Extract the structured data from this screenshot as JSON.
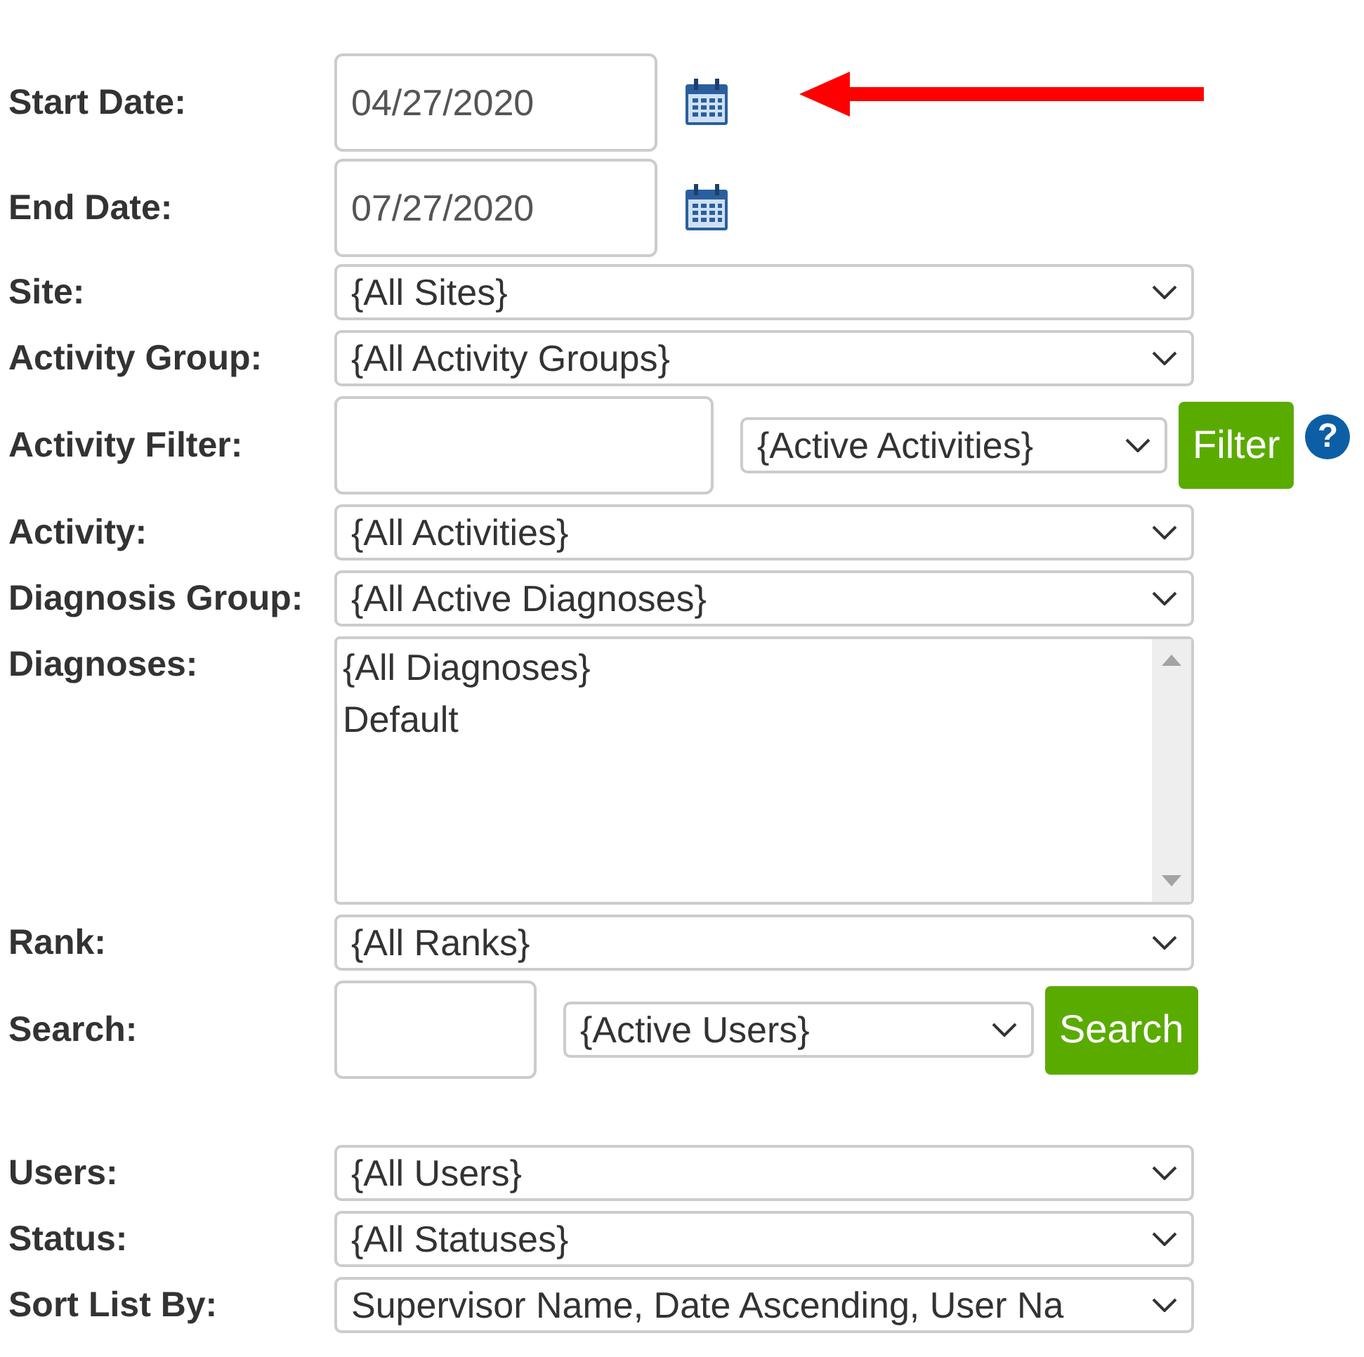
{
  "fields": [
    {
      "kind": "date",
      "label": "Start Date:",
      "value": "04/27/2020",
      "pointed_at": true
    },
    {
      "kind": "date",
      "label": "End Date:",
      "value": "07/27/2020",
      "pointed_at": false
    },
    {
      "kind": "select",
      "label": "Site:",
      "value": "{All Sites}"
    },
    {
      "kind": "select",
      "label": "Activity Group:",
      "value": "{All Activity Groups}"
    },
    {
      "kind": "filter",
      "label": "Activity Filter:",
      "select": "{Active Activities}",
      "button": "Filter",
      "help": "?"
    },
    {
      "kind": "select",
      "label": "Activity:",
      "value": "{All Activities}"
    },
    {
      "kind": "select",
      "label": "Diagnosis Group:",
      "value": "{All Active Diagnoses}"
    },
    {
      "kind": "listbox",
      "label": "Diagnoses:",
      "options": [
        "{All Diagnoses}",
        "Default"
      ]
    },
    {
      "kind": "select",
      "label": "Rank:",
      "value": "{All Ranks}"
    },
    {
      "kind": "search",
      "label": "Search:",
      "select": "{Active Users}",
      "button": "Search"
    },
    {
      "kind": "select",
      "label": "Users:",
      "value": "{All Users}"
    },
    {
      "kind": "select",
      "label": "Status:",
      "value": "{All Statuses}"
    },
    {
      "kind": "select",
      "label": "Sort List By:",
      "value": "Supervisor Name, Date Ascending, User Na"
    }
  ]
}
